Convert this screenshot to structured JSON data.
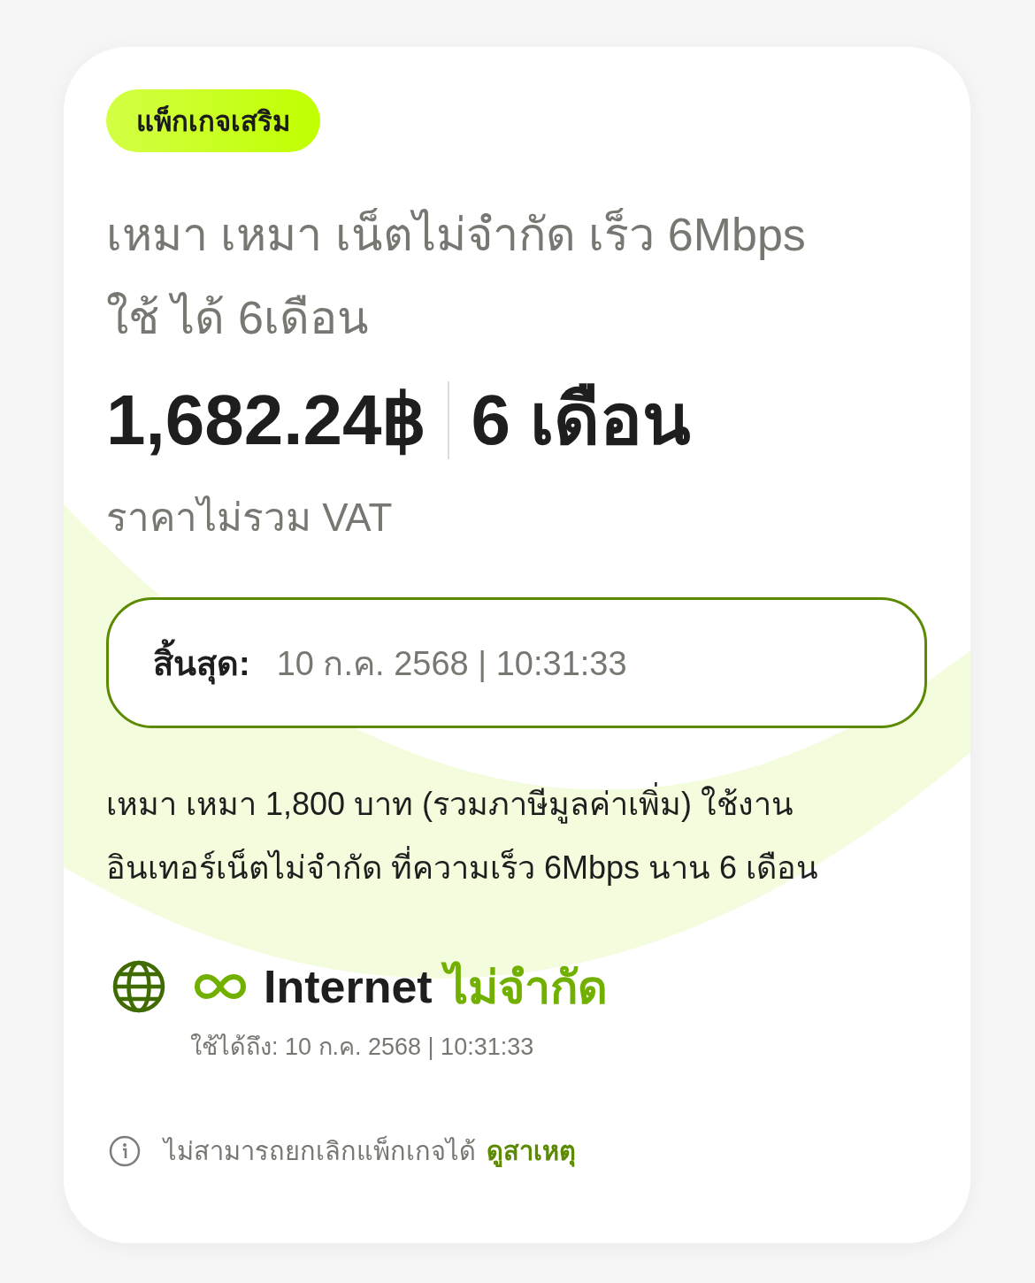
{
  "badge": {
    "label": "แพ็กเกจเสริม"
  },
  "package": {
    "title": "เหมา เหมา เน็ตไม่จำกัด เร็ว 6Mbps ใช้ ได้ 6เดือน",
    "price": "1,682.24฿",
    "duration": "6 เดือน",
    "price_note": "ราคาไม่รวม VAT"
  },
  "expiry": {
    "label": "สิ้นสุด:",
    "value": "10 ก.ค. 2568 | 10:31:33"
  },
  "description": "เหมา เหมา 1,800 บาท (รวมภาษีมูลค่าเพิ่ม) ใช้งาน อินเทอร์เน็ตไม่จำกัด ที่ความเร็ว 6Mbps นาน 6 เดือน",
  "benefits": [
    {
      "kind": "internet",
      "name": "Internet",
      "quota": "ไม่จำกัด",
      "valid_until": "ใช้ได้ถึง: 10 ก.ค. 2568 | 10:31:33"
    }
  ],
  "notice": {
    "text": "ไม่สามารถยกเลิกแพ็กเกจได้",
    "link": "ดูสาเหตุ"
  }
}
